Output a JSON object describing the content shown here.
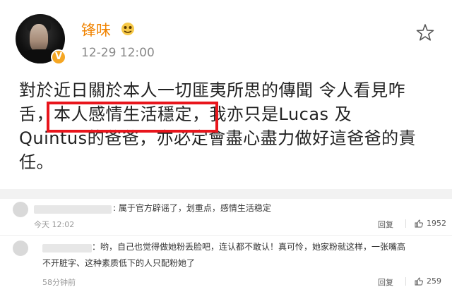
{
  "post": {
    "username": "锋味",
    "timestamp": "12-29 12:00",
    "verified_badge": "V",
    "lines": [
      "對於近日關於本人一切匪夷所思的傳聞 令人看見咋",
      "舌，本人感情生活穩定，我亦只是Lucas 及",
      "Quintus的爸爸，亦必定會盡心盡力做好這爸爸的責",
      "任。"
    ],
    "colors": {
      "username": "#f08300",
      "highlight_box": "#e8151c",
      "badge": "#f5a623"
    }
  },
  "comments": [
    {
      "text": ":  属于官方辟谣了，划重点，感情生活稳定",
      "time": "今天 12:02",
      "reply_label": "回复",
      "likes": "1952"
    },
    {
      "text_lines": [
        "：哟，自己也觉得做她粉丢脸吧，连认都不敢认！真可怜，她家粉就这样，一张嘴高",
        "不开脏字、这种素质低下的人只配粉她了"
      ],
      "time": "58分钟前",
      "reply_label": "回复",
      "likes": "259"
    }
  ],
  "icons": {
    "star": "star-outline-icon",
    "vip": "vip-emoji-icon",
    "thumb": "thumbs-up-icon"
  }
}
